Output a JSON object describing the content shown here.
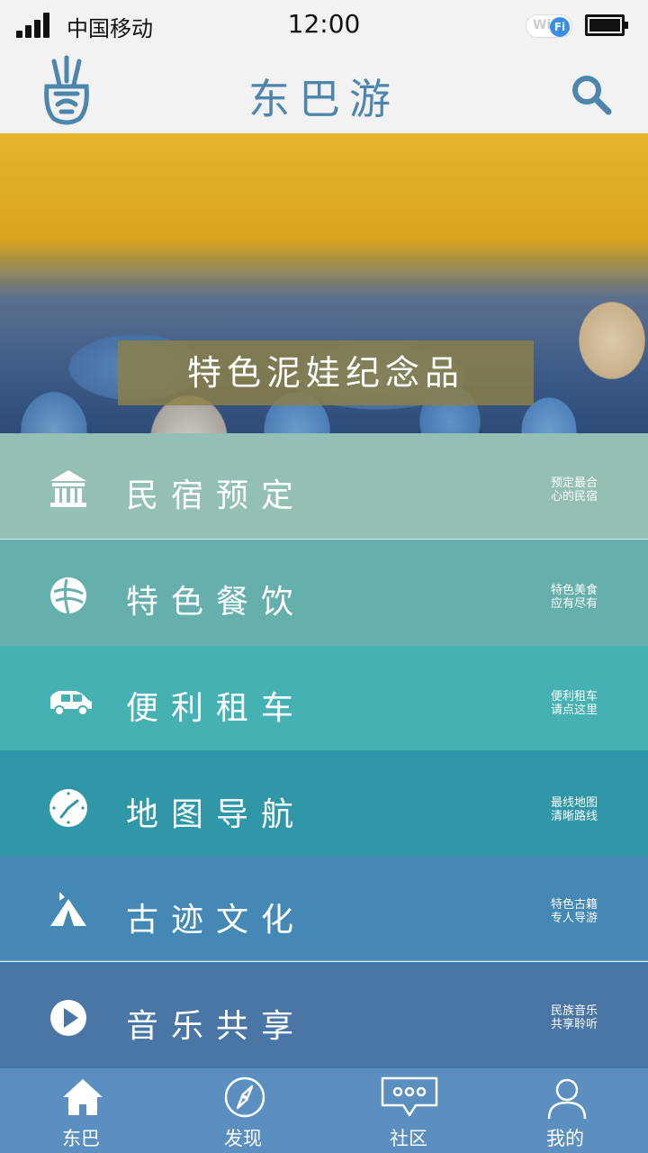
{
  "status_bar": {
    "carrier": "中国移动",
    "time": "12:00",
    "wifi_text": "Wi",
    "wifi_badge": "Fi"
  },
  "header": {
    "title": "东巴游"
  },
  "banner": {
    "caption": "特色泥娃纪念品"
  },
  "menu": [
    {
      "label": "民宿预定",
      "sub_line1": "预定最合",
      "sub_line2": "心的民宿",
      "icon": "building-icon",
      "color": "#93bfb5"
    },
    {
      "label": "特色餐饮",
      "sub_line1": "特色美食",
      "sub_line2": "应有尽有",
      "icon": "food-icon",
      "color": "#65afad"
    },
    {
      "label": "便利租车",
      "sub_line1": "便利租车",
      "sub_line2": "请点这里",
      "icon": "car-icon",
      "color": "#46b1b3"
    },
    {
      "label": "地图导航",
      "sub_line1": "最线地图",
      "sub_line2": "清晰路线",
      "icon": "clock-icon",
      "color": "#2f97a8"
    },
    {
      "label": "古迹文化",
      "sub_line1": "特色古籍",
      "sub_line2": "专人导游",
      "icon": "tent-icon",
      "color": "#4488b6"
    },
    {
      "label": "音乐共享",
      "sub_line1": "民族音乐",
      "sub_line2": "共享聆听",
      "icon": "play-icon",
      "color": "#4a76a5"
    }
  ],
  "tabs": [
    {
      "label": "东巴",
      "icon": "home-icon"
    },
    {
      "label": "发现",
      "icon": "compass-icon"
    },
    {
      "label": "社区",
      "icon": "chat-icon"
    },
    {
      "label": "我的",
      "icon": "user-icon"
    }
  ]
}
